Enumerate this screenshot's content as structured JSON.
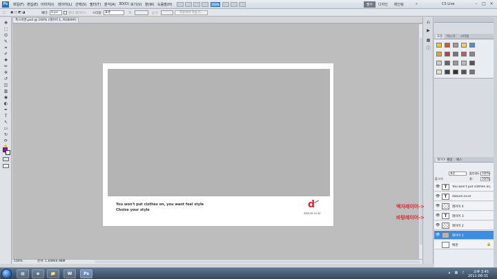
{
  "menubar": {
    "logo": "Ps",
    "items": [
      "파일(F)",
      "편집(E)",
      "이미지(I)",
      "레이어(L)",
      "선택(S)",
      "필터(T)",
      "분석(A)",
      "3D(D)",
      "보기(V)",
      "창(W)",
      "도움말(H)"
    ],
    "zoom": "100%",
    "workspaces": [
      "필수",
      "디자인",
      "페인팅"
    ],
    "more": "»",
    "cs_live": "CS Live",
    "window_controls": [
      "–",
      "□",
      "×"
    ]
  },
  "options": {
    "feather_label": "페더:",
    "feather_value": "0 px",
    "antialias_label": "앤티 앨리어스",
    "style_label": "스타일:",
    "style_value": "표준",
    "width_label": "폭:",
    "height_label": "높이:",
    "refine_edge": "가장자리 다듬기..."
  },
  "document": {
    "tab_title": "폭스바겐.psd @ 100% (레이어 1, RGB/8#)",
    "copy_line1": "You won't put clothes on, you want feel style",
    "copy_line2": "Choise your style",
    "brand_logo": "d",
    "brand_url": "dazure.co.kr"
  },
  "status": {
    "zoom": "100%",
    "doc_info": "문서: 1.64M/4.98M"
  },
  "toolbox": {
    "tools": [
      "move-tool",
      "marquee-tool",
      "lasso-tool",
      "quick-selection-tool",
      "crop-tool",
      "eyedropper-tool",
      "healing-brush-tool",
      "brush-tool",
      "clone-stamp-tool",
      "history-brush-tool",
      "eraser-tool",
      "gradient-tool",
      "blur-tool",
      "dodge-tool",
      "pen-tool",
      "type-tool",
      "path-selection-tool",
      "shape-tool",
      "3d-rotate-tool",
      "3d-orbit-tool",
      "hand-tool",
      "zoom-tool"
    ],
    "glyphs": [
      "✥",
      "⬚",
      "ʘ",
      "✎",
      "⌗",
      "✐",
      "✚",
      "✏",
      "✲",
      "↺",
      "◫",
      "▥",
      "◉",
      "◐",
      "✒",
      "T",
      "↖",
      "▭",
      "↻",
      "⟳",
      "✋",
      "⚲"
    ],
    "fg_color": "#a200c4",
    "bg_color": "#ffffff"
  },
  "adjustments": {
    "tabs": [
      "조정",
      "마스크",
      "스타일"
    ]
  },
  "layers": {
    "tabs": [
      "레이어",
      "채널",
      "패스"
    ],
    "blend_mode": "표준",
    "opacity_label": "불투명도:",
    "opacity": "100%",
    "lock_label": "잠그기:",
    "fill_label": "칠:",
    "fill": "100%",
    "rows": [
      {
        "name": "You won't put clothes on,...",
        "type": "text",
        "selected": false
      },
      {
        "name": "dazure.co.kr",
        "type": "text",
        "selected": false
      },
      {
        "name": "레이어 4",
        "type": "layer",
        "selected": false
      },
      {
        "name": "레이어 3",
        "type": "text",
        "selected": false
      },
      {
        "name": "레이어 2",
        "type": "layer",
        "selected": false
      },
      {
        "name": "레이어 1",
        "type": "image",
        "selected": true
      },
      {
        "name": "배경",
        "type": "background",
        "selected": false
      }
    ]
  },
  "annotations": {
    "frame_layer": "액자레이어->",
    "background_layer": "바탕레이어->"
  },
  "taskbar": {
    "time": "오후 3:45",
    "date": "2011-08-31",
    "apps": [
      "e",
      "📁",
      "W",
      "Ps"
    ]
  }
}
